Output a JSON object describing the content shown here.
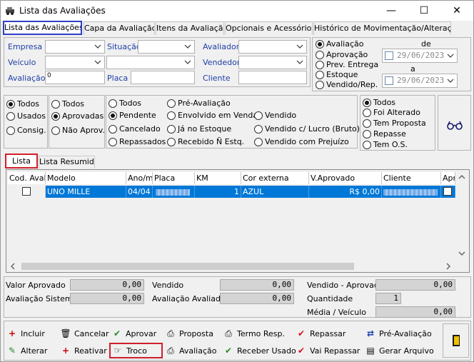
{
  "window": {
    "title": "Lista das Avaliações",
    "minimize": "—",
    "maximize": "☐",
    "close": "✕"
  },
  "tabs": [
    "Lista das Avaliações",
    "Capa da Avaliação",
    "Itens da Avaliação",
    "Opcionais e Acessórios",
    "Histórico de Movimentação/Alterações"
  ],
  "filters": {
    "empresa": "Empresa",
    "veiculo": "Veículo",
    "avaliacao": "Avaliação",
    "avaliacao_value": "0",
    "situacao": "Situação",
    "placa": "Placa",
    "avaliador": "Avaliador",
    "vendedor": "Vendedor",
    "cliente": "Cliente"
  },
  "date_filter": {
    "options": [
      "Avaliação",
      "Aprovação",
      "Prev. Entrega",
      "Estoque",
      "Vendido/Rep."
    ],
    "selected": 0,
    "de": "de",
    "a": "a",
    "date_from": "29/06/2023",
    "date_to": "29/06/2023"
  },
  "group1": {
    "options": [
      "Todos",
      "Usados",
      "Consig."
    ],
    "selected": 0
  },
  "group2": {
    "options": [
      "Todos",
      "Aprovadas",
      "Não Aprov."
    ],
    "selected": 1
  },
  "group3": {
    "options": [
      "Todos",
      "Pré-Avaliação",
      "Pendente",
      "Envolvido em Venda",
      "Vendido",
      "Cancelado",
      "Já no Estoque",
      "Vendido c/ Lucro (Bruto)",
      "Repassados",
      "Recebido Ñ Estq.",
      "Vendido com Prejuízo"
    ],
    "selected": 2
  },
  "group4": {
    "options": [
      "Todos",
      "Foi Alterado",
      "Tem Proposta",
      "Repasse",
      "Tem O.S."
    ],
    "selected": 0
  },
  "list_tabs": [
    "Lista",
    "Lista Resumida"
  ],
  "grid": {
    "columns": [
      "Cod. Aval",
      "Modelo",
      "Ano/m",
      "Placa",
      "KM",
      "Cor externa",
      "V.Aprovado",
      "Cliente",
      "Apr"
    ],
    "rows": [
      {
        "modelo": "UNO MILLE",
        "ano": "04/04",
        "km": "1",
        "cor": "AZUL",
        "valor": "R$ 0,00"
      }
    ]
  },
  "summary": {
    "valor_aprovado": "Valor Aprovado",
    "valor_aprovado_v": "0,00",
    "avaliacao_sistema": "Avaliação Sistema",
    "avaliacao_sistema_v": "0,00",
    "vendido": "Vendido",
    "vendido_v": "0,00",
    "avaliacao_avaliador": "Avaliação Avaliador",
    "avaliacao_avaliador_v": "0,00",
    "vendido_aprovado": "Vendido - Aprovado",
    "vendido_aprovado_v": "0,00",
    "quantidade": "Quantidade",
    "quantidade_v": "1",
    "media_veiculo": "Média / Veículo",
    "media_veiculo_v": "0,00"
  },
  "actions": {
    "incluir": "Incluir",
    "cancelar": "Cancelar",
    "aprovar": "Aprovar",
    "proposta": "Proposta",
    "termo_resp": "Termo Resp.",
    "repassar": "Repassar",
    "pre_avaliacao": "Pré-Avaliação",
    "alterar": "Alterar",
    "reativar": "Reativar",
    "troco": "Troco",
    "avaliacao": "Avaliação",
    "receber_usado": "Receber Usado",
    "vai_repassar": "Vai Repassar",
    "gerar_arquivo": "Gerar Arquivo"
  }
}
